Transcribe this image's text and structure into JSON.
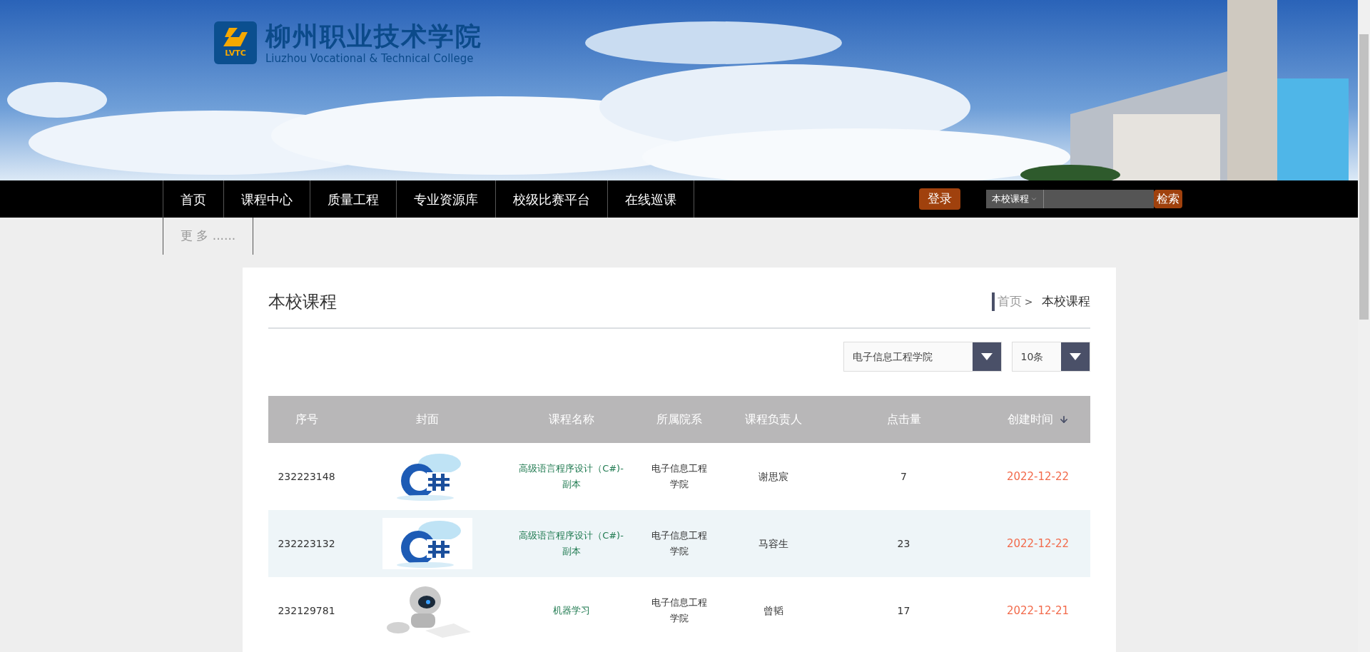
{
  "header": {
    "logo": {
      "badge": "LVTC",
      "name": "柳州职业技术学院",
      "english": "Liuzhou Vocational & Technical College"
    }
  },
  "nav": {
    "items": [
      {
        "label": "首页"
      },
      {
        "label": "课程中心"
      },
      {
        "label": "质量工程"
      },
      {
        "label": "专业资源库"
      },
      {
        "label": "校级比赛平台"
      },
      {
        "label": "在线巡课"
      }
    ],
    "more": "更 多 ......",
    "login": "登录",
    "search": {
      "scope": "本校课程",
      "button": "检索"
    }
  },
  "page": {
    "title": "本校课程",
    "breadcrumb": [
      {
        "label": "首页"
      },
      {
        "label": "本校课程"
      }
    ],
    "separator": ">"
  },
  "filters": [
    {
      "value": "电子信息工程学院"
    },
    {
      "value": "10条"
    }
  ],
  "table": {
    "columns": [
      {
        "label": "序号",
        "sorted": false
      },
      {
        "label": "封面",
        "sorted": false
      },
      {
        "label": "课程名称",
        "sorted": false
      },
      {
        "label": "所属院系",
        "sorted": false
      },
      {
        "label": "课程负责人",
        "sorted": false
      },
      {
        "label": "点击量",
        "sorted": false
      },
      {
        "label": "创建时间",
        "sorted": true
      }
    ],
    "rows": [
      {
        "id": "232223148",
        "name": "高级语言程序设计（C#)-副本",
        "department": "电子信息工程学院",
        "owner": "谢思宸",
        "clicks": "7",
        "created": "2022-12-22"
      },
      {
        "id": "232223132",
        "name": "高级语言程序设计（C#)-副本",
        "department": "电子信息工程学院",
        "owner": "马容生",
        "clicks": "23",
        "created": "2022-12-22"
      },
      {
        "id": "232129781",
        "name": "机器学习",
        "department": "电子信息工程学院",
        "owner": "曾韬",
        "clicks": "17",
        "created": "2022-12-21"
      }
    ]
  }
}
